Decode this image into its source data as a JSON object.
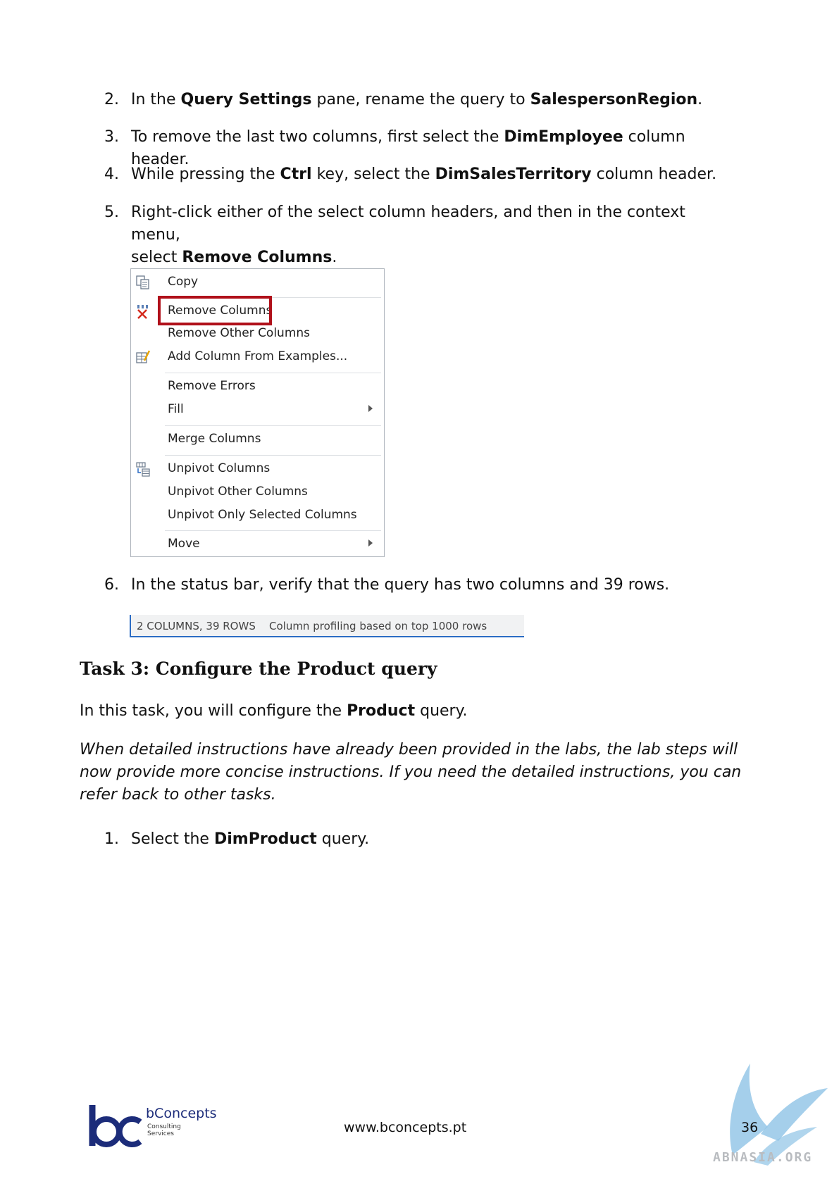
{
  "steps": [
    {
      "num": "2.",
      "pre": "In the ",
      "b1": "Query Settings",
      "mid": " pane, rename the query to ",
      "b2": "SalespersonRegion",
      "post": "."
    },
    {
      "num": "3.",
      "pre": "To remove the last two columns, first select the ",
      "b1": "DimEmployee",
      "post": " column header."
    },
    {
      "num": "4.",
      "pre": "While pressing the ",
      "b1": "Ctrl",
      "mid": " key, select the ",
      "b2": "DimSalesTerritory",
      "post": " column header."
    },
    {
      "num": "5.",
      "line1": "Right-click either of the select column headers, and then in the context menu,",
      "pre2": "select ",
      "b1": "Remove Columns",
      "post": "."
    }
  ],
  "menu": {
    "items": [
      "Copy",
      "Remove Columns",
      "Remove Other Columns",
      "Add Column From Examples...",
      "Remove Errors",
      "Fill",
      "Merge Columns",
      "Unpivot Columns",
      "Unpivot Other Columns",
      "Unpivot Only Selected Columns",
      "Move"
    ]
  },
  "step6": {
    "num": "6.",
    "text": "In the status bar, verify that the query has two columns and 39 rows."
  },
  "status_bar": {
    "count": "2 COLUMNS, 39 ROWS",
    "profiling": "Column profiling based on top 1000 rows"
  },
  "task_heading": "Task 3: Configure the Product query",
  "intro": {
    "pre": "In this task, you will configure the ",
    "b": "Product",
    "post": " query."
  },
  "italic_note": "When detailed instructions have already been provided in the labs, the lab steps will now provide more concise instructions. If you need the detailed instructions, you can refer back to other tasks.",
  "step1": {
    "num": "1.",
    "pre": "Select the ",
    "b": "DimProduct",
    "post": " query."
  },
  "footer": {
    "url": "www.bconcepts.pt",
    "brand": "bConcepts",
    "brand_sub1": "Consulting",
    "brand_sub2": "Services",
    "page": "36",
    "watermark": "ABNASIA.ORG"
  }
}
